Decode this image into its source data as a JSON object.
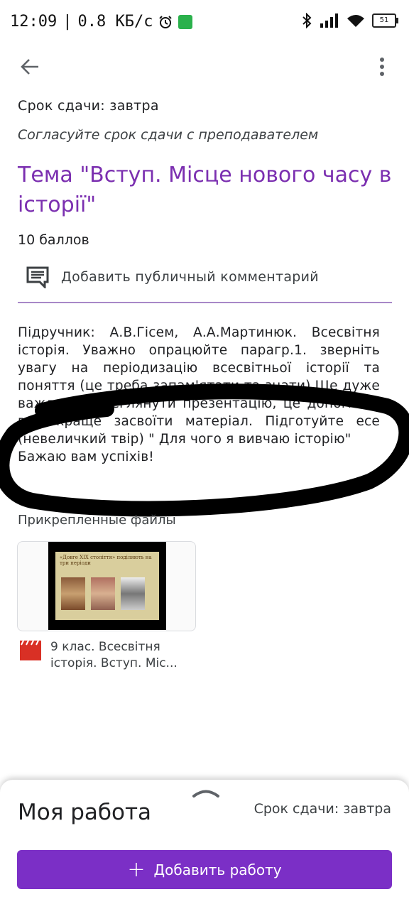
{
  "status_bar": {
    "time": "12:09",
    "separator": "|",
    "speed": "0.8 КБ/с",
    "battery": "51",
    "icons": [
      "alarm-icon",
      "exercise-icon",
      "bluetooth-icon",
      "signal-icon",
      "wifi-icon",
      "battery-icon"
    ]
  },
  "assignment": {
    "due": "Срок сдачи: завтра",
    "agree_note": "Согласуйте срок сдачи с преподавателем",
    "title": "Тема \"Вступ. Місце нового часу в історії\"",
    "points": "10 баллов",
    "comment_label": "Добавить публичный комментарий",
    "description": {
      "line1": "Підручник: А.В.Гісем, А.А.Мартинюк. Всесвітня історія. Уважно опрацюйте парагр.1. зверніть увагу на періодизацію всесвітньої історії та поняття (це треба запам'ятати та знати).Ще дуже важливо переглянути презентацію, це допоможе вам краще засвоїти матеріал. Підготуйте есе (невеличкий твір) \" Для чого я вивчаю історію\"",
      "line2": "Бажаю вам успіхів!"
    }
  },
  "attachments": {
    "label": "Прикрепленные файлы",
    "file": {
      "thumb_title": "«Довге XIX століття» поділяють на три періоди",
      "name": "9 клас. Всесвітня\nісторія. Вступ. Міс..."
    }
  },
  "my_work": {
    "title": "Моя работа",
    "due": "Срок сдачи: завтра",
    "add_button": "Добавить работу",
    "plus": "+"
  },
  "colors": {
    "accent": "#7b2fc6",
    "title": "#7b2fb0",
    "divider": "#a888c8",
    "file_icon": "#d93025"
  }
}
